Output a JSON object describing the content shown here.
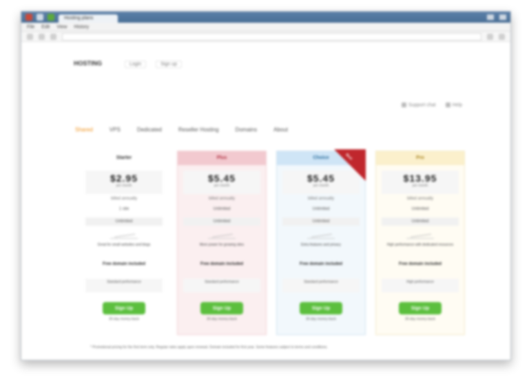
{
  "browser": {
    "tab_title": "Hosting plans",
    "menu": [
      "File",
      "Edit",
      "View",
      "History"
    ],
    "address": ""
  },
  "site": {
    "logo": "HOSTING",
    "auth": [
      "Login",
      "Sign up"
    ],
    "top_right": [
      "Support chat",
      "Help"
    ]
  },
  "nav": {
    "items": [
      "Shared",
      "VPS",
      "Dedicated",
      "Reseller Hosting",
      "Domains",
      "About"
    ]
  },
  "plans": [
    {
      "name": "Starter",
      "price": "$2.95",
      "price_suffix": "per month",
      "per_line": "billed annually",
      "row1": "1 site",
      "row2": "Unlimited",
      "description": "Great for small websites and blogs",
      "bold": "Free domain included",
      "feature": "Standard performance",
      "cta": "Sign Up",
      "cta_note": "30-day money-back"
    },
    {
      "name": "Plus",
      "price": "$5.45",
      "price_suffix": "per month",
      "per_line": "billed annually",
      "row1": "Unlimited",
      "row2": "Unlimited",
      "description": "More power for growing sites",
      "bold": "Free domain included",
      "feature": "Standard performance",
      "cta": "Sign Up",
      "cta_note": "30-day money-back"
    },
    {
      "name": "Choice",
      "price": "$5.45",
      "price_suffix": "per month",
      "per_line": "billed annually",
      "row1": "Unlimited",
      "row2": "Unlimited",
      "description": "Extra features and privacy",
      "bold": "Free domain included",
      "feature": "Standard performance",
      "cta": "Sign Up",
      "cta_note": "30-day money-back",
      "ribbon": "Best"
    },
    {
      "name": "Pro",
      "price": "$13.95",
      "price_suffix": "per month",
      "per_line": "billed annually",
      "row1": "Unlimited",
      "row2": "Unlimited",
      "description": "High performance with dedicated resources",
      "bold": "Free domain included",
      "feature": "High performance",
      "cta": "Sign Up",
      "cta_note": "30-day money-back"
    }
  ],
  "colors": {
    "accent": "#f0921b",
    "cta": "#5cbf3e",
    "plan2": "#f2c9cf",
    "plan3": "#cfe5f6",
    "plan4": "#fbf0cc",
    "ribbon": "#c0272d"
  },
  "footnote": "* Promotional pricing for the first term only. Regular rates apply upon renewal. Domain included for first year. Some features subject to terms and conditions."
}
